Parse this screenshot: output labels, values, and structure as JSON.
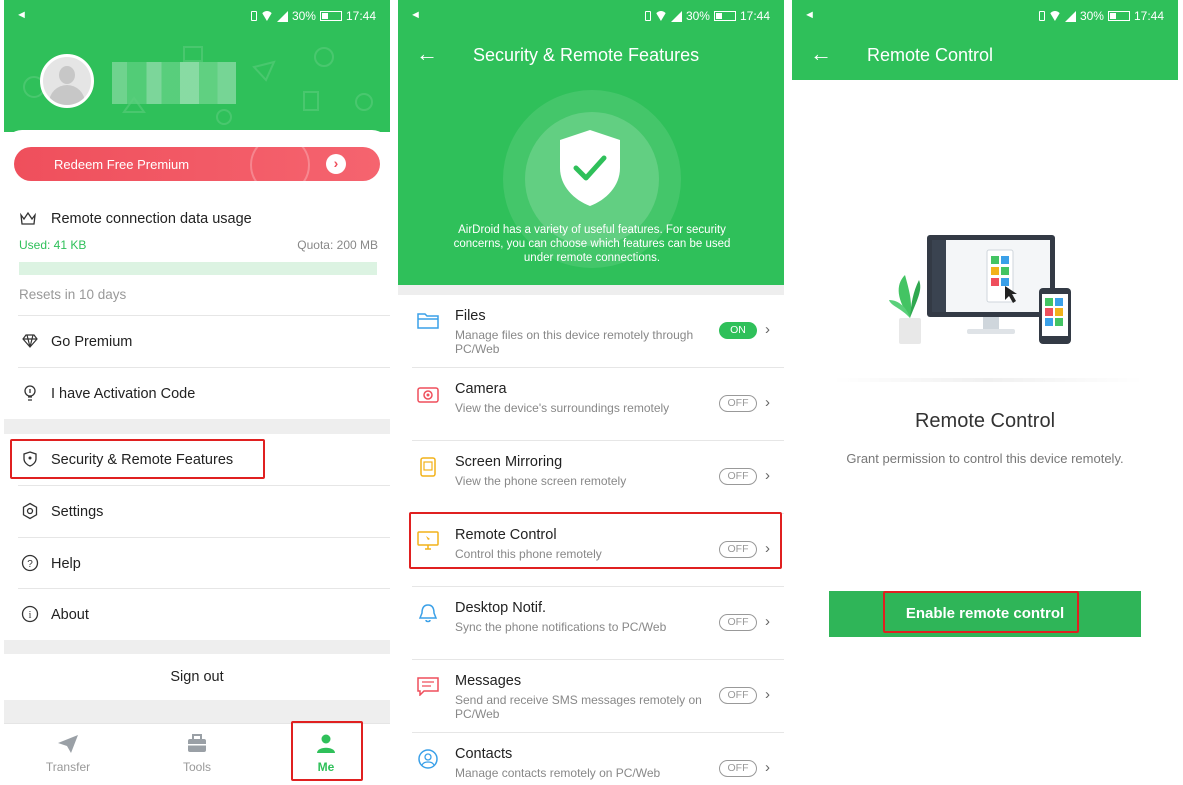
{
  "status_bar": {
    "battery": "30%",
    "time": "17:44"
  },
  "screen_me": {
    "redeem_label": "Redeem Free Premium",
    "usage": {
      "title": "Remote connection data usage",
      "used": "Used: 41 KB",
      "quota": "Quota: 200 MB",
      "fill_fraction": 0.0002,
      "resets": "Resets in 10 days"
    },
    "menu": [
      {
        "label": "Go Premium",
        "icon": "diamond-icon"
      },
      {
        "label": "I have Activation Code",
        "icon": "lightbulb-icon"
      },
      {
        "label": "Security & Remote Features",
        "icon": "shield-icon"
      },
      {
        "label": "Settings",
        "icon": "hexagon-settings-icon"
      },
      {
        "label": "Help",
        "icon": "help-icon"
      },
      {
        "label": "About",
        "icon": "info-icon"
      }
    ],
    "sign_out": "Sign out",
    "nav": [
      {
        "label": "Transfer",
        "icon": "paper-plane-icon"
      },
      {
        "label": "Tools",
        "icon": "toolbox-icon"
      },
      {
        "label": "Me",
        "icon": "person-icon",
        "active": true
      }
    ]
  },
  "screen_security": {
    "title": "Security & Remote Features",
    "hero_text": "AirDroid has a variety of useful features. For security concerns, you can choose which features can be used under remote connections.",
    "features": [
      {
        "title": "Files",
        "desc": "Manage files on this device remotely through PC/Web",
        "state": "ON",
        "icon": "folder-icon"
      },
      {
        "title": "Camera",
        "desc": "View the device's surroundings remotely",
        "state": "OFF",
        "icon": "camera-icon"
      },
      {
        "title": "Screen Mirroring",
        "desc": "View the phone screen remotely",
        "state": "OFF",
        "icon": "screen-mirror-icon"
      },
      {
        "title": "Remote Control",
        "desc": "Control this phone remotely",
        "state": "OFF",
        "icon": "remote-control-icon"
      },
      {
        "title": "Desktop Notif.",
        "desc": "Sync the phone notifications to PC/Web",
        "state": "OFF",
        "icon": "bell-icon"
      },
      {
        "title": "Messages",
        "desc": "Send and receive SMS messages remotely on PC/Web",
        "state": "OFF",
        "icon": "message-icon"
      },
      {
        "title": "Contacts",
        "desc": "Manage contacts remotely on PC/Web",
        "state": "OFF",
        "icon": "contacts-icon"
      }
    ],
    "colors": {
      "accent": "#2fc05a",
      "files": "#3aa0e8",
      "camera": "#ef4f5c",
      "mirror": "#f2b21a",
      "remote": "#f2b21a",
      "notif": "#3aa0e8",
      "messages": "#ef4f5c",
      "contacts": "#3aa0e8"
    }
  },
  "screen_remote": {
    "title": "Remote Control",
    "heading": "Remote Control",
    "desc": "Grant permission to control this device remotely.",
    "button": "Enable remote control"
  },
  "colors": {
    "accent": "#2fc05a",
    "highlight": "#e02020",
    "redeem": "#ef4f5c"
  }
}
